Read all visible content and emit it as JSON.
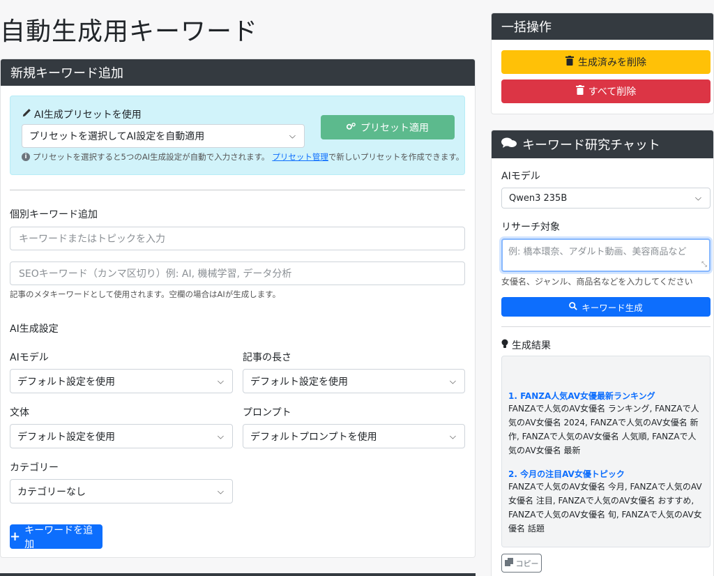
{
  "page": {
    "title": "自動生成用キーワード"
  },
  "main": {
    "header": "新規キーワード追加",
    "preset": {
      "label": "AI生成プリセットを使用",
      "select_value": "プリセットを選択してAI設定を自動適用",
      "apply_button": "プリセット適用",
      "note_before": "プリセットを選択すると5つのAI生成設定が自動で入力されます。",
      "note_link": "プリセット管理",
      "note_after": "で新しいプリセットを作成できます。"
    },
    "individual": {
      "label": "個別キーワード追加",
      "keyword_placeholder": "キーワードまたはトピックを入力",
      "seo_placeholder": "SEOキーワード（カンマ区切り）例: AI, 機械学習, データ分析",
      "seo_help": "記事のメタキーワードとして使用されます。空欄の場合はAIが生成します。"
    },
    "ai_settings": {
      "heading": "AI生成設定",
      "model_label": "AIモデル",
      "model_value": "デフォルト設定を使用",
      "length_label": "記事の長さ",
      "length_value": "デフォルト設定を使用",
      "style_label": "文体",
      "style_value": "デフォルト設定を使用",
      "prompt_label": "プロンプト",
      "prompt_value": "デフォルトプロンプトを使用",
      "category_label": "カテゴリー",
      "category_value": "カテゴリーなし"
    },
    "add_button": "キーワードを追加"
  },
  "bulk": {
    "header": "一括操作",
    "delete_generated": "生成済みを削除",
    "delete_all": "すべて削除"
  },
  "chat": {
    "header": "キーワード研究チャット",
    "model_label": "AIモデル",
    "model_value": "Qwen3 235B",
    "target_label": "リサーチ対象",
    "target_placeholder": "例: 橋本環奈、アダルト動画、美容商品など",
    "target_help": "女優名、ジャンル、商品名などを入力してください",
    "generate_button": "キーワード生成",
    "results_label": "生成結果",
    "results": [
      {
        "title": "1. FANZA人気AV女優最新ランキング",
        "body": "FANZAで人気のAV女優名 ランキング, FANZAで人気のAV女優名 2024, FANZAで人気のAV女優名 新作, FANZAで人気のAV女優名 人気順, FANZAで人気のAV女優名 最新"
      },
      {
        "title": "2. 今月の注目AV女優トピック",
        "body": "FANZAで人気のAV女優名 今月, FANZAで人気のAV女優名 注目, FANZAで人気のAV女優名 おすすめ, FANZAで人気のAV女優名 旬, FANZAで人気のAV女優名 話題"
      }
    ],
    "copy_button": "コピー"
  }
}
